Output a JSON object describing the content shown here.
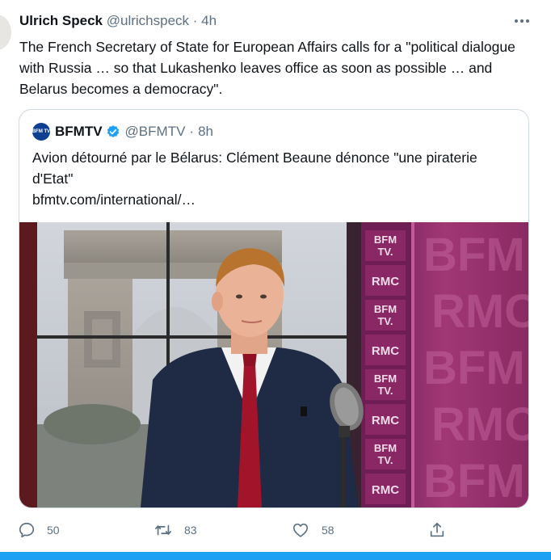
{
  "author": {
    "name": "Ulrich Speck",
    "handle": "@ulrichspeck",
    "separator": "·",
    "time": "4h"
  },
  "tweet": {
    "text": "The French Secretary of State for European Affairs calls for a \"political dialogue with Russia … so that Lukashenko leaves office as soon as possible … and Belarus becomes a democracy\"."
  },
  "quoted": {
    "name": "BFMTV",
    "handle": "@BFMTV",
    "separator": "·",
    "time": "8h",
    "avatar_text": "BFM TV",
    "text": "Avion détourné par le Bélarus: Clément Beaune dénonce \"une piraterie d'Etat\"",
    "link": "bfmtv.com/international/…",
    "media": {
      "backdrop_tiles": [
        "BFM TV.",
        "RMC",
        "BFM TV.",
        "RMC",
        "BFM TV.",
        "RMC",
        "BFM TV.",
        "RMC"
      ],
      "backdrop_big": [
        "BFM",
        "RMC",
        "BFM",
        "RMC",
        "BFM"
      ]
    }
  },
  "actions": {
    "reply_count": "50",
    "retweet_count": "83",
    "like_count": "58"
  },
  "colors": {
    "text": "#0f1419",
    "secondary": "#5b7083",
    "verified": "#1da1f2",
    "accent_bar": "#1da1f2",
    "backdrop": "#8a2a63"
  },
  "icons": [
    "more-icon",
    "verified-icon",
    "reply-icon",
    "retweet-icon",
    "like-icon",
    "share-icon"
  ]
}
